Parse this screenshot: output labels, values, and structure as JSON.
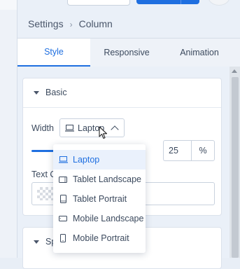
{
  "breadcrumb": {
    "parent": "Settings",
    "current": "Column"
  },
  "tabs": [
    {
      "label": "Style",
      "active": true
    },
    {
      "label": "Responsive",
      "active": false
    },
    {
      "label": "Animation",
      "active": false
    }
  ],
  "basic_section": {
    "title": "Basic",
    "width_label": "Width",
    "device_select_value": "Laptop",
    "width_value": "25",
    "width_unit": "%",
    "text_color_label": "Text C"
  },
  "second_section": {
    "title": "Sp"
  },
  "device_dropdown": {
    "items": [
      {
        "label": "Laptop",
        "icon": "laptop-icon",
        "selected": true
      },
      {
        "label": "Tablet Landscape",
        "icon": "tablet-landscape-icon",
        "selected": false
      },
      {
        "label": "Tablet Portrait",
        "icon": "tablet-portrait-icon",
        "selected": false
      },
      {
        "label": "Mobile Landscape",
        "icon": "mobile-landscape-icon",
        "selected": false
      },
      {
        "label": "Mobile Portrait",
        "icon": "mobile-portrait-icon",
        "selected": false
      }
    ]
  },
  "colors": {
    "accent": "#1f6fe0",
    "panel_bg": "#eaf0f8",
    "text": "#3c4a5e"
  }
}
